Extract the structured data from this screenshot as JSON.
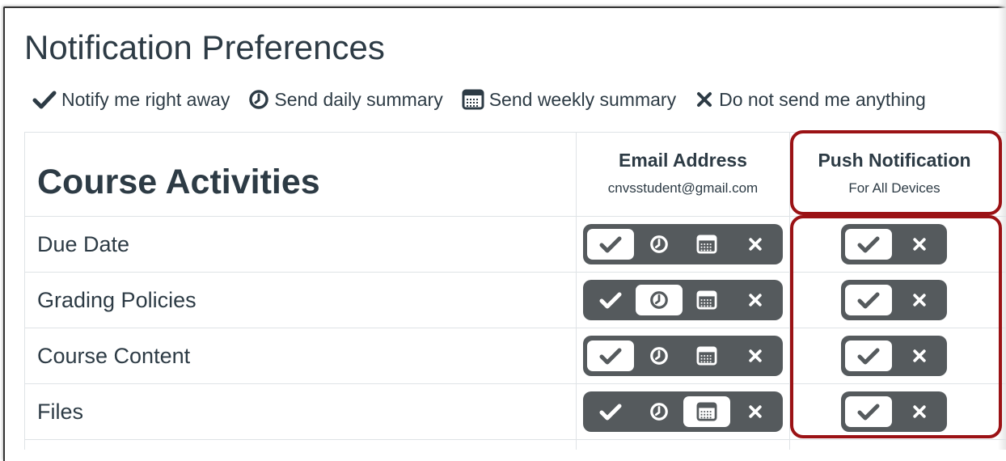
{
  "page": {
    "title": "Notification Preferences"
  },
  "legend": [
    {
      "icon": "checkmark-icon",
      "label": "Notify me right away"
    },
    {
      "icon": "clock-icon",
      "label": "Send daily summary"
    },
    {
      "icon": "calendar-icon",
      "label": "Send weekly summary"
    },
    {
      "icon": "x-icon",
      "label": "Do not send me anything"
    }
  ],
  "table": {
    "category_header": "Course Activities",
    "columns": [
      {
        "title": "Email Address",
        "subtitle": "cnvsstudent@gmail.com"
      },
      {
        "title": "Push Notification",
        "subtitle": "For All Devices"
      }
    ],
    "rows": [
      {
        "label": "Due Date",
        "email_selected": "right_away",
        "push_selected": "right_away"
      },
      {
        "label": "Grading Policies",
        "email_selected": "daily",
        "push_selected": "right_away"
      },
      {
        "label": "Course Content",
        "email_selected": "right_away",
        "push_selected": "right_away"
      },
      {
        "label": "Files",
        "email_selected": "weekly",
        "push_selected": "right_away"
      }
    ]
  },
  "colors": {
    "text": "#2d3b45",
    "toggle_background": "#555a5d",
    "highlight": "#9b1215",
    "table_border": "#dfe3e6"
  }
}
